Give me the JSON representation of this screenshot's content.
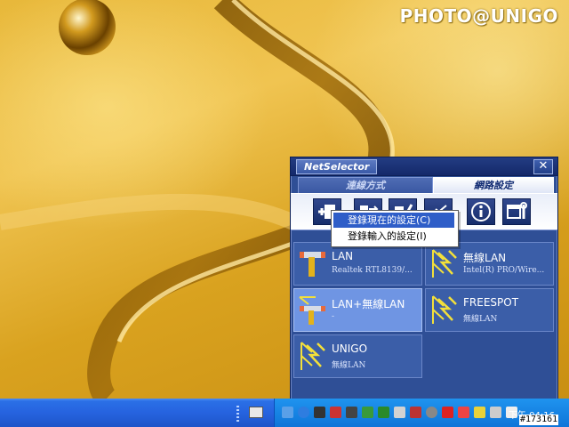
{
  "desktop": {
    "watermark": "PHOTO@UNIGO"
  },
  "netselector": {
    "title": "NetSelector",
    "close_label": "✕",
    "tabs": [
      {
        "label": "連線方式",
        "active": false
      },
      {
        "label": "網路設定",
        "active": true
      }
    ],
    "toolbar": [
      {
        "icon": "add-profile-icon"
      },
      {
        "icon": "transfer-icon"
      },
      {
        "icon": "edit-icon"
      },
      {
        "icon": "delete-icon"
      },
      {
        "icon": "info-icon"
      },
      {
        "icon": "settings-icon"
      }
    ],
    "profiles": [
      {
        "name": "LAN",
        "sub": "Realtek RTL8139/...",
        "icon": "lan-icon",
        "selected": false
      },
      {
        "name": "無線LAN",
        "sub": "Intel(R) PRO/Wire...",
        "icon": "wireless-icon",
        "selected": false
      },
      {
        "name": "LAN+無線LAN",
        "sub": "-",
        "icon": "lan-wireless-icon",
        "selected": true
      },
      {
        "name": "FREESPOT",
        "sub": "無線LAN",
        "icon": "wireless-icon",
        "selected": false
      },
      {
        "name": "UNIGO",
        "sub": "無線LAN",
        "icon": "wireless-icon",
        "selected": false
      }
    ]
  },
  "context_menu": {
    "items": [
      {
        "label": "登錄現在的設定(C)",
        "highlighted": true
      },
      {
        "label": "登錄輸入的設定(I)",
        "highlighted": false
      }
    ]
  },
  "taskbar": {
    "clock": "下午 04:16",
    "stamp": "#173161"
  },
  "colors": {
    "window": "#2f4f96",
    "selected_profile": "#6f95e3",
    "menu_highlight": "#2f5ec8",
    "taskbar": "#2663df"
  }
}
